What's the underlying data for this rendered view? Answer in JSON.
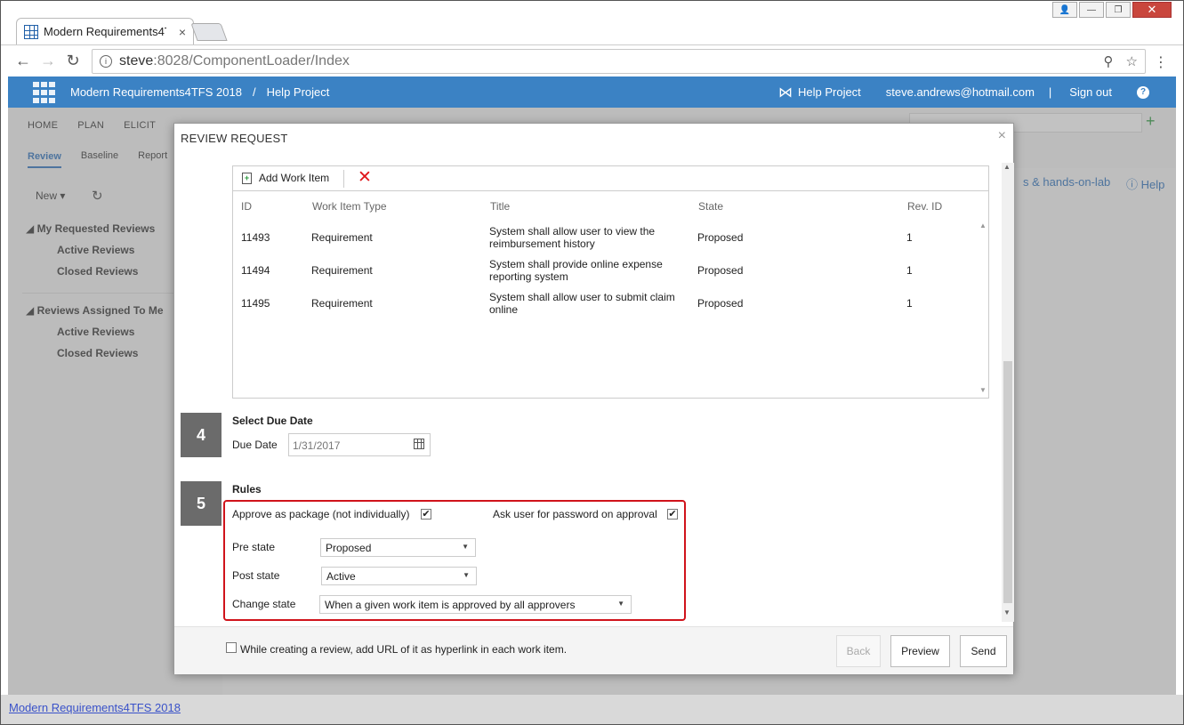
{
  "browser": {
    "tab_title": "Modern Requirements4T",
    "tab_close": "×",
    "url_host": "steve",
    "url_rest": ":8028/ComponentLoader/Index",
    "window_buttons": {
      "user": "👤",
      "minimize": "—",
      "maximize": "❐",
      "close": "✕"
    }
  },
  "header": {
    "app_name": "Modern Requirements4TFS 2018",
    "separator": "/",
    "project": "Help Project",
    "right_project": "Help Project",
    "user_email": "steve.andrews@hotmail.com",
    "pipe": "|",
    "sign_out": "Sign out",
    "help_glyph": "?"
  },
  "background": {
    "menu": [
      "HOME",
      "PLAN",
      "ELICIT"
    ],
    "subtabs": {
      "active": "Review",
      "others": [
        "Baseline",
        "Report"
      ]
    },
    "new_label": "New ▾",
    "my_requested": "My Requested Reviews",
    "assigned_to_me": "Reviews Assigned To Me",
    "active_reviews": "Active Reviews",
    "closed_reviews": "Closed Reviews",
    "right_link_1": "s & hands-on-lab",
    "right_link_2": "Help",
    "footer_link": "Modern Requirements4TFS 2018"
  },
  "modal": {
    "title": "REVIEW REQUEST",
    "close": "×",
    "add_work_item": "Add Work Item",
    "grid": {
      "columns": [
        "ID",
        "Work Item Type",
        "Title",
        "State",
        "Rev. ID"
      ],
      "rows": [
        {
          "id": "11493",
          "type": "Requirement",
          "title": "System shall allow user to view the reimbursement history",
          "state": "Proposed",
          "rev": "1"
        },
        {
          "id": "11494",
          "type": "Requirement",
          "title": "System shall provide online expense reporting system",
          "state": "Proposed",
          "rev": "1"
        },
        {
          "id": "11495",
          "type": "Requirement",
          "title": "System shall allow user to submit claim online",
          "state": "Proposed",
          "rev": "1"
        }
      ]
    },
    "step4": {
      "number": "4",
      "title": "Select Due Date",
      "due_label": "Due Date",
      "due_value": "1/31/2017"
    },
    "step5": {
      "number": "5",
      "title": "Rules",
      "approve_package_label": "Approve as package (not individually)",
      "approve_package_checked": "✔",
      "ask_password_label": "Ask user for password on approval",
      "ask_password_checked": "✔",
      "pre_state_label": "Pre state",
      "pre_state_value": "Proposed",
      "post_state_label": "Post state",
      "post_state_value": "Active",
      "change_state_label": "Change state",
      "change_state_value": "When a given work item is approved by all approvers"
    },
    "footer": {
      "hyperlink_label": "While creating a review, add URL of it as hyperlink in each work item.",
      "back": "Back",
      "preview": "Preview",
      "send": "Send"
    }
  },
  "colors": {
    "accent": "#3b82c4",
    "rules_border": "#d0131b",
    "delete": "#e0161a"
  }
}
